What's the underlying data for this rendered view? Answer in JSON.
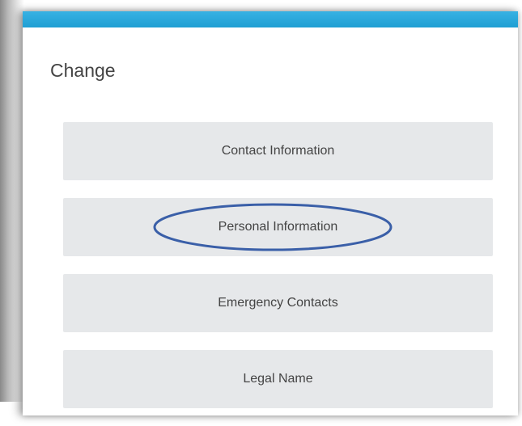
{
  "dialog": {
    "heading": "Change",
    "accent_color": "#2aa7d9",
    "options": [
      {
        "label": "Contact Information"
      },
      {
        "label": "Personal Information",
        "highlighted": true
      },
      {
        "label": "Emergency Contacts"
      },
      {
        "label": "Legal Name"
      }
    ],
    "highlight_color": "#3a5fa8"
  }
}
